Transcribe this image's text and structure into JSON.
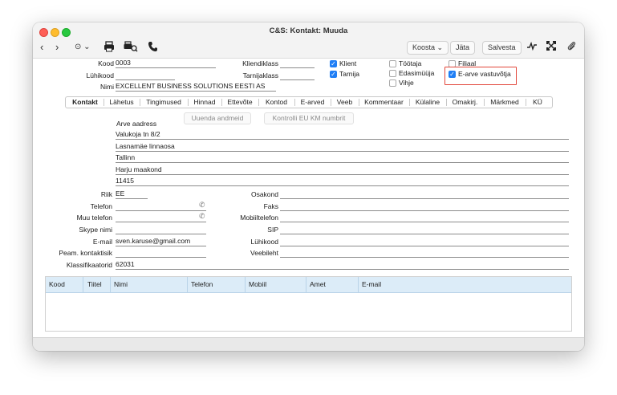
{
  "window": {
    "title": "C&S: Kontakt: Muuda"
  },
  "toolbar": {
    "back": "‹",
    "forward": "›",
    "more": "⊙ ⌄",
    "koosta": "Koosta",
    "jata": "Jäta",
    "salvesta": "Salvesta"
  },
  "header": {
    "kood_label": "Kood",
    "kood_value": "0003",
    "luhikood_label": "Lühikood",
    "luhikood_value": "",
    "nimi_label": "Nimi",
    "nimi_value": "EXCELLENT BUSINESS SOLUTIONS EESTI AS",
    "kliendiklass_label": "Kliendiklass",
    "kliendiklass_value": "",
    "tarnijaklass_label": "Tarnijaklass",
    "tarnijaklass_value": ""
  },
  "checkboxes": {
    "klient": "Klient",
    "tarnija": "Tarnija",
    "tootaja": "Töötaja",
    "edasimuuja": "Edasimüüja",
    "vihje": "Vihje",
    "filiaal": "Filiaal",
    "earve": "E-arve vastuvõtja"
  },
  "tabs": [
    "Kontakt",
    "Lähetus",
    "Tingimused",
    "Hinnad",
    "Ettevõte",
    "Kontod",
    "E-arved",
    "Veeb",
    "Kommentaar",
    "Külaline",
    "Omakirj.",
    "Märkmed",
    "KÜ"
  ],
  "address": {
    "title": "Arve aadress",
    "update_button": "Uuenda andmeid",
    "check_button": "Kontrolli EU KM numbrit",
    "line1": "Valukoja tn 8/2",
    "line2": "Lasnamäe linnaosa",
    "line3": "Tallinn",
    "line4": "Harju maakond",
    "line5": "11415"
  },
  "fields": {
    "riik_label": "Riik",
    "riik_value": "EE",
    "telefon_label": "Telefon",
    "telefon_value": "",
    "muu_telefon_label": "Muu telefon",
    "muu_telefon_value": "",
    "skype_label": "Skype nimi",
    "skype_value": "",
    "email_label": "E-mail",
    "email_value": "sven.karuse@gmail.com",
    "peam_label": "Peam. kontaktisik",
    "peam_value": "",
    "klassifikaator_label": "Klassifikaatorid",
    "klassifikaator_value": "62031",
    "osakond_label": "Osakond",
    "faks_label": "Faks",
    "mobiiltelefon_label": "Mobiiltelefon",
    "sip_label": "SIP",
    "luhikood2_label": "Lühikood",
    "veebileht_label": "Veebileht"
  },
  "grid": {
    "columns": [
      "Kood",
      "Tiitel",
      "Nimi",
      "Telefon",
      "Mobiil",
      "Amet",
      "E-mail"
    ]
  }
}
